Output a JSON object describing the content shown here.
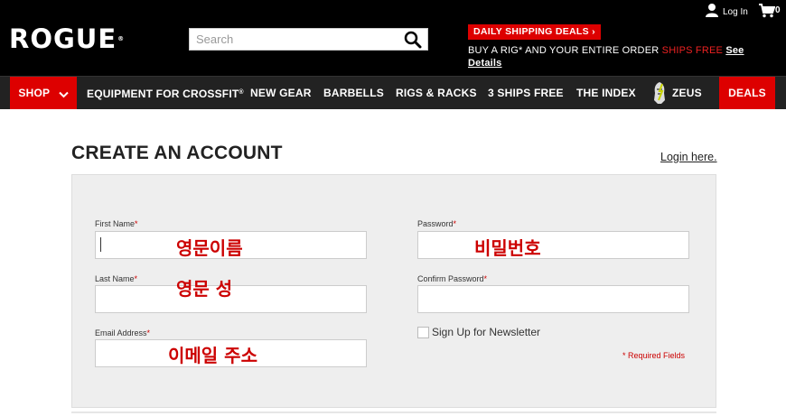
{
  "header": {
    "logo": "ROGUE",
    "logo_tm": "®",
    "search_placeholder": "Search",
    "promo_button": "DAILY SHIPPING DEALS ›",
    "promo_line_prefix": "BUY A RIG* AND YOUR ENTIRE ORDER",
    "promo_line_red": "SHIPS FREE",
    "promo_line_link": "See Details",
    "login_label": "Log In",
    "cart_count": "0"
  },
  "nav": {
    "shop": "SHOP",
    "crossfit": "EQUIPMENT FOR CROSSFIT",
    "crossfit_reg": "®",
    "new_gear": "NEW GEAR",
    "barbells": "BARBELLS",
    "rigs": "RIGS & RACKS",
    "ships_free": "3 SHIPS FREE",
    "index": "THE INDEX",
    "zeus": "ZEUS",
    "deals": "DEALS"
  },
  "page": {
    "title": "CREATE AN ACCOUNT",
    "login_link": "Login here."
  },
  "form": {
    "first_name_label": "First Name",
    "last_name_label": "Last Name",
    "email_label": "Email Address",
    "password_label": "Password",
    "confirm_password_label": "Confirm Password",
    "required_marker": "*",
    "newsletter_label": "Sign Up for Newsletter",
    "required_note": "* Required Fields",
    "first_name_value": "",
    "last_name_value": "",
    "email_value": "",
    "password_value": "",
    "confirm_password_value": ""
  },
  "annotations": {
    "first_name": "영문이름",
    "last_name": "영문 성",
    "email": "이메일 주소",
    "password": "비밀번호"
  },
  "colors": {
    "brand_red": "#dd0000",
    "header_bg": "#000000",
    "nav_bg": "#222222",
    "panel_bg": "#eeeeee",
    "annotation_red": "#cc0000"
  },
  "icons": [
    "search-icon",
    "user-icon",
    "cart-icon",
    "chevron-down-icon",
    "zeus-helmet-icon"
  ]
}
